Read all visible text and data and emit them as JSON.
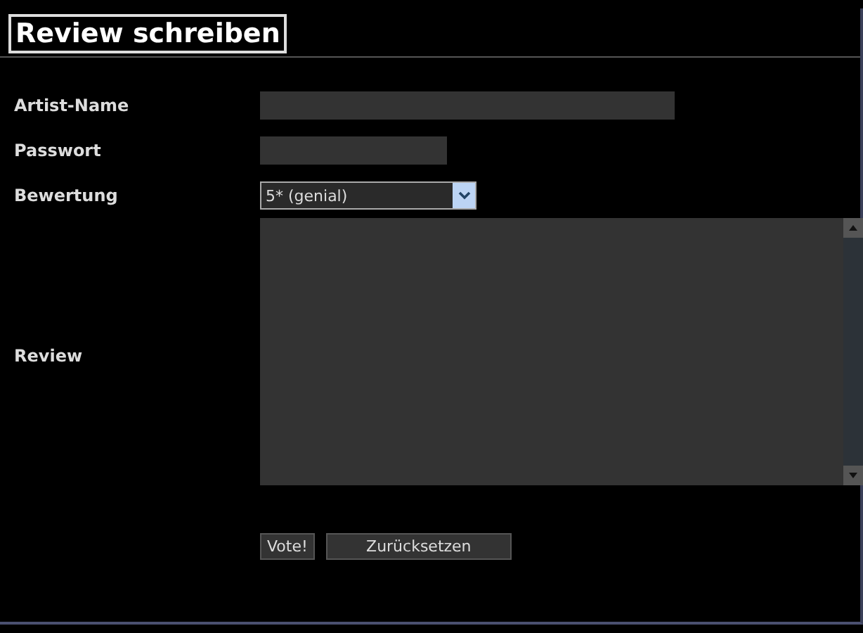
{
  "title": "Review schreiben",
  "fields": [
    {
      "kind": "text",
      "label": "Artist-Name"
    },
    {
      "kind": "password",
      "label": "Passwort"
    },
    {
      "kind": "select",
      "label": "Bewertung",
      "value": "5* (genial)"
    },
    {
      "kind": "textarea",
      "label": "Review"
    }
  ],
  "buttons": [
    "Vote!",
    "Zurücksetzen"
  ]
}
